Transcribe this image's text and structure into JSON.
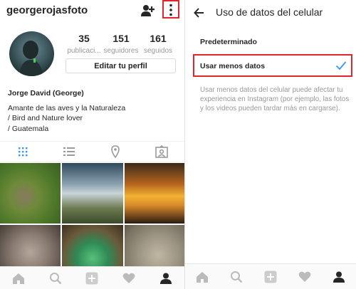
{
  "profile": {
    "username": "georgerojasfoto",
    "stats": [
      {
        "value": "35",
        "label": "publicaci..."
      },
      {
        "value": "151",
        "label": "seguidores"
      },
      {
        "value": "161",
        "label": "seguidos"
      }
    ],
    "edit_button": "Editar tu perfil",
    "bio_name": "Jorge David (George)",
    "bio_lines": [
      "Amante de las aves y la Naturaleza",
      "/ Bird and Nature lover",
      "/ Guatemala"
    ],
    "tabs": [
      "grid-icon",
      "list-icon",
      "location-icon",
      "tagged-icon"
    ],
    "highlight_color": "#e0252b"
  },
  "settings": {
    "title": "Uso de datos del celular",
    "section_label": "Predeterminado",
    "option_label": "Usar menos datos",
    "option_selected": true,
    "description": "Usar menos datos del celular puede afectar tu experiencia en Instagram (por ejemplo, las fotos y los videos pueden tardar más en cargarse).",
    "check_color": "#3897f0"
  },
  "bottom_nav": [
    "home-icon",
    "search-icon",
    "add-icon",
    "heart-icon",
    "profile-icon"
  ]
}
